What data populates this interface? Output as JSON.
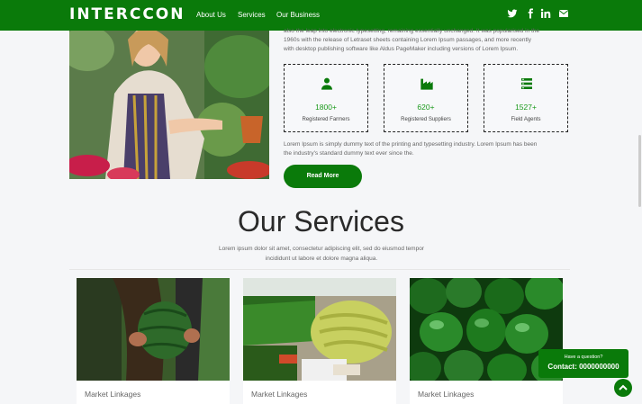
{
  "colors": {
    "brand": "#0a7a0a",
    "accent": "#1c9a1c"
  },
  "header": {
    "brand": "INTERCCON",
    "nav": [
      "About Us",
      "Services",
      "Our Business"
    ],
    "social_icons": [
      "twitter-icon",
      "facebook-icon",
      "linkedin-icon",
      "email-icon"
    ]
  },
  "about": {
    "text_top": [
      "also the leap into electronic typesetting, remaining essentially unchanged. It was popularised in the",
      "1960s with the release of Letraset sheets containing Lorem Ipsum passages, and more recently",
      "with desktop publishing software like Aldus PageMaker including versions of Lorem Ipsum."
    ],
    "stats": [
      {
        "icon": "user-icon",
        "value": "1800+",
        "label": "Registered Farmers"
      },
      {
        "icon": "industry-icon",
        "value": "620+",
        "label": "Registered Suppliers"
      },
      {
        "icon": "list-icon",
        "value": "1527+",
        "label": "Field Agents"
      }
    ],
    "text_bottom": [
      "Lorem Ipsum is simply dummy text of the printing and typesetting industry. Lorem Ipsum has been",
      "the industry's standard dummy text ever since the."
    ],
    "read_more": "Read More"
  },
  "services": {
    "title": "Our Services",
    "subtitle": [
      "Lorem ipsum dolor sit amet, consectetur adipiscing elit, sed do eiusmod tempor",
      "incididunt ut labore et dolore magna aliqua."
    ],
    "cards": [
      {
        "label": "Market Linkages"
      },
      {
        "label": "Market Linkages"
      },
      {
        "label": "Market Linkages"
      }
    ]
  },
  "contact": {
    "question": "Have a question?",
    "phone": "Contact: 0000000000"
  }
}
